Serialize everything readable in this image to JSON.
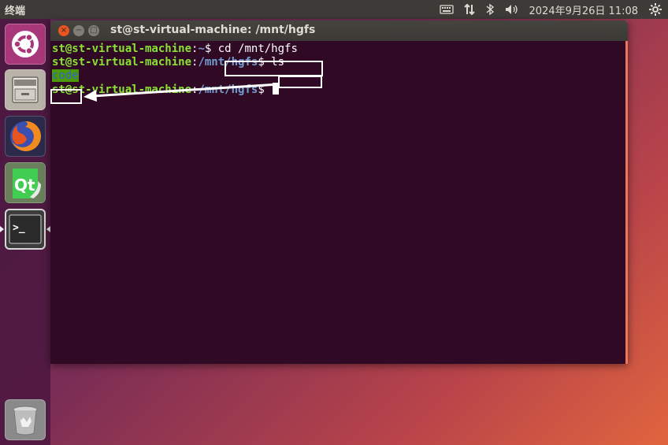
{
  "top_panel": {
    "app_name": "终端",
    "clock": "2024年9月26日 11:08",
    "icons": [
      "keyboard-icon",
      "network-icon",
      "bluetooth-icon",
      "volume-icon",
      "gear-icon"
    ]
  },
  "launcher": {
    "items": [
      {
        "name": "ubuntu-dash",
        "icon": "ubuntu-logo-icon"
      },
      {
        "name": "files",
        "icon": "file-cabinet-icon"
      },
      {
        "name": "firefox",
        "icon": "firefox-icon"
      },
      {
        "name": "qt-creator",
        "icon": "qt-icon",
        "glyph": "Qt"
      },
      {
        "name": "terminal",
        "icon": "terminal-icon",
        "glyph": ">_",
        "active": true
      },
      {
        "name": "trash",
        "icon": "trash-icon"
      }
    ]
  },
  "window": {
    "title": "st@st-virtual-machine: /mnt/hgfs",
    "close_glyph": "×",
    "min_glyph": "−",
    "max_glyph": "□"
  },
  "terminal": {
    "lines": [
      {
        "user": "st@st-virtual-machine",
        "sep": ":",
        "path": "~",
        "prompt": "$ ",
        "command": "cd /mnt/hgfs"
      },
      {
        "user": "st@st-virtual-machine",
        "sep": ":",
        "path": "/mnt/hgfs",
        "prompt": "$ ",
        "command": "ls"
      },
      {
        "output": "code"
      },
      {
        "user": "st@st-virtual-machine",
        "sep": ":",
        "path": "/mnt/hgfs",
        "prompt": "$ "
      }
    ]
  },
  "colors": {
    "terminal_bg": "#300a24",
    "user_green": "#8ae234",
    "path_blue": "#729fcf",
    "accent_orange": "#e95420",
    "panel_bg": "#3c3b37"
  }
}
